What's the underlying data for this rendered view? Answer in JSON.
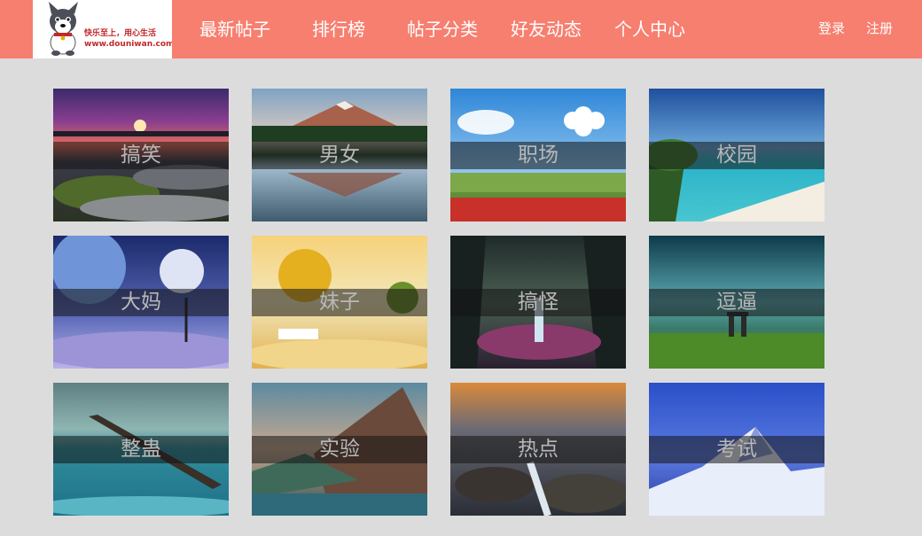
{
  "header": {
    "logo": {
      "slogan": "快乐至上，用心生活",
      "url": "www.douniwan.com"
    },
    "nav": [
      "最新帖子",
      "排行榜",
      "帖子分类",
      "好友动态",
      "个人中心"
    ],
    "auth": {
      "login": "登录",
      "register": "注册"
    }
  },
  "categories": [
    {
      "label": "搞笑",
      "scene": "sunset-coast"
    },
    {
      "label": "男女",
      "scene": "mountain-lake"
    },
    {
      "label": "职场",
      "scene": "sky-flower-field"
    },
    {
      "label": "校园",
      "scene": "tropical-beach"
    },
    {
      "label": "大妈",
      "scene": "moons-night"
    },
    {
      "label": "妹子",
      "scene": "autumn-park"
    },
    {
      "label": "搞怪",
      "scene": "fantasy-forest"
    },
    {
      "label": "逗逼",
      "scene": "aurora-field"
    },
    {
      "label": "整蛊",
      "scene": "pier-sea"
    },
    {
      "label": "实验",
      "scene": "mountain-coast"
    },
    {
      "label": "热点",
      "scene": "rocky-shore"
    },
    {
      "label": "考试",
      "scene": "snow-mountain-night"
    }
  ],
  "colors": {
    "header_bg": "#f77f70",
    "page_bg": "#dcdcdc",
    "label_text": "#b8b8b8"
  }
}
